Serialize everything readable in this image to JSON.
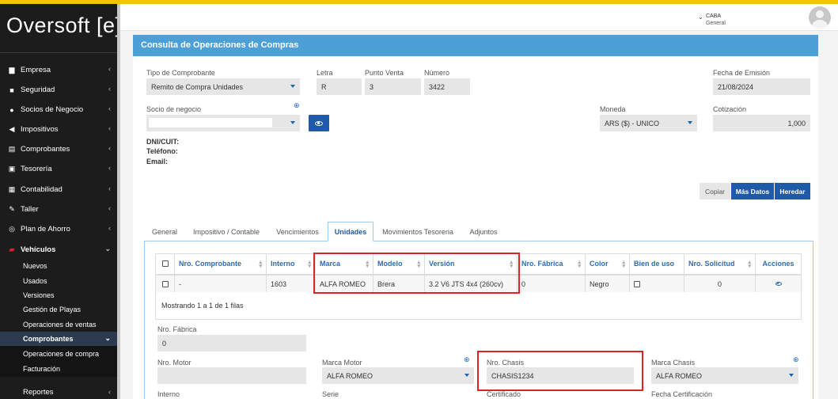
{
  "app": {
    "logo": "Oversoft [e]"
  },
  "sidebar": {
    "items": [
      {
        "label": "Empresa",
        "icon": "building-icon"
      },
      {
        "label": "Seguridad",
        "icon": "lock-icon"
      },
      {
        "label": "Socios de Negocio",
        "icon": "user-icon"
      },
      {
        "label": "Impositivos",
        "icon": "megaphone-icon"
      },
      {
        "label": "Comprobantes",
        "icon": "document-icon"
      },
      {
        "label": "Tesorería",
        "icon": "money-icon"
      },
      {
        "label": "Contabilidad",
        "icon": "calculator-icon"
      },
      {
        "label": "Taller",
        "icon": "wrench-icon"
      },
      {
        "label": "Plan de Ahorro",
        "icon": "handshake-icon"
      },
      {
        "label": "Vehículos",
        "icon": "car-icon"
      }
    ],
    "vehiculos_sub": [
      "Nuevos",
      "Usados",
      "Versiones",
      "Gestión de Playas",
      "Operaciones de ventas"
    ],
    "comprobantes_sub_label": "Comprobantes",
    "comprobantes_sub": [
      "Operaciones de compra",
      "Facturación"
    ],
    "reportes": "Reportes"
  },
  "header": {
    "location": "CABA",
    "location_sub": "General"
  },
  "panel": {
    "title": "Consulta de Operaciones de Compras"
  },
  "form": {
    "tipo_label": "Tipo de Comprobante",
    "tipo_value": "Remito de Compra Unidades",
    "letra_label": "Letra",
    "letra_value": "R",
    "punto_label": "Punto Venta",
    "punto_value": "3",
    "numero_label": "Número",
    "numero_value": "3422",
    "fecha_label": "Fecha de Emisión",
    "fecha_value": "21/08/2024",
    "socio_label": "Socio de negocio",
    "socio_value": "",
    "moneda_label": "Moneda",
    "moneda_value": "ARS ($) - UNICO",
    "cotizacion_label": "Cotización",
    "cotizacion_value": "1,000",
    "dni_label": "DNI/CUIT:",
    "telefono_label": "Teléfono:",
    "email_label": "Email:"
  },
  "actions": {
    "copiar": "Copiar",
    "mas_datos": "Más Datos",
    "heredar": "Heredar"
  },
  "tabs": [
    "General",
    "Impositivo / Contable",
    "Vencimientos",
    "Unidades",
    "Movimientos Tesoreria",
    "Adjuntos"
  ],
  "table": {
    "headers": [
      "Nro. Comprobante",
      "Interno",
      "Marca",
      "Modelo",
      "Versión",
      "Nro. Fábrica",
      "Color",
      "Bien de uso",
      "Nro. Solicitud",
      "Acciones"
    ],
    "row": {
      "comprobante": "-",
      "interno": "1603",
      "marca": "ALFA ROMEO",
      "modelo": "Brera",
      "version": "3.2 V6 JTS 4x4 (260cv)",
      "fabrica": "0",
      "color": "Negro",
      "solicitud": "0"
    },
    "footer": "Mostrando 1 a 1 de 1 filas"
  },
  "detail": {
    "fabrica_label": "Nro. Fábrica",
    "fabrica_value": "0",
    "motor_label": "Nro. Motor",
    "motor_value": "",
    "marca_motor_label": "Marca Motor",
    "marca_motor_value": "ALFA ROMEO",
    "chasis_label": "Nro. Chasis",
    "chasis_value": "CHASIS1234",
    "marca_chasis_label": "Marca Chasis",
    "marca_chasis_value": "ALFA ROMEO",
    "interno_label": "Interno",
    "serie_label": "Serie",
    "certificado_label": "Certificado",
    "fecha_cert_label": "Fecha Certificación"
  },
  "colors": {
    "accent": "#1e5aa8",
    "panel_header": "#4d9fd8",
    "highlight": "#d9252a",
    "topbar": "#f3c400"
  }
}
